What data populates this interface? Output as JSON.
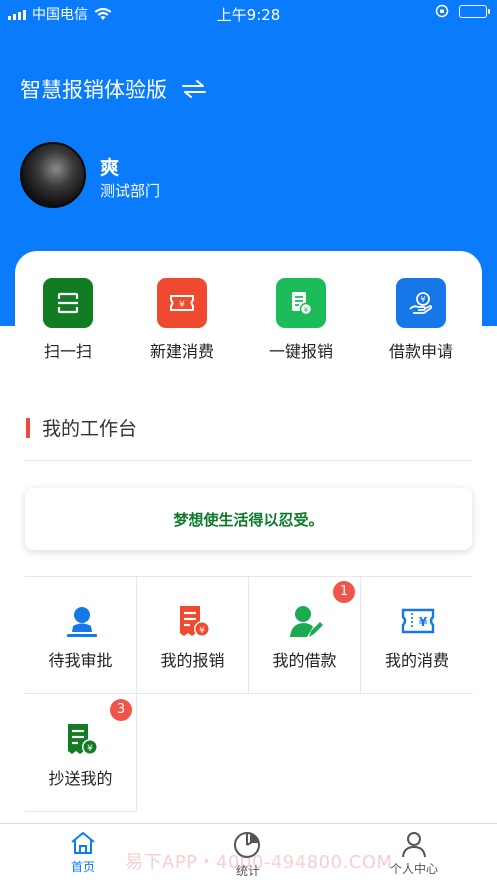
{
  "status_bar": {
    "carrier": "中国电信",
    "time": "上午9:28"
  },
  "header": {
    "app_title": "智慧报销体验版",
    "switch_icon": "switch-arrows-icon",
    "user_name": "爽",
    "department": "测试部门"
  },
  "quick_actions": [
    {
      "label": "扫一扫",
      "icon": "scan-icon",
      "color": "#127c23"
    },
    {
      "label": "新建消费",
      "icon": "ticket-icon",
      "color": "#ef4a30"
    },
    {
      "label": "一键报销",
      "icon": "receipt-check-icon",
      "color": "#1cbc5a"
    },
    {
      "label": "借款申请",
      "icon": "hand-money-icon",
      "color": "#1677e8"
    }
  ],
  "workbench": {
    "title": "我的工作台",
    "quote": "梦想使生活得以忍受。",
    "items": [
      {
        "label": "待我审批",
        "icon": "approver-icon",
        "color": "#1677e8",
        "badge": ""
      },
      {
        "label": "我的报销",
        "icon": "reimburse-icon",
        "color": "#ef4a30",
        "badge": ""
      },
      {
        "label": "我的借款",
        "icon": "user-edit-icon",
        "color": "#1aaa50",
        "badge": "1"
      },
      {
        "label": "我的消费",
        "icon": "ticket-yen-icon",
        "color": "#1677e8",
        "badge": ""
      },
      {
        "label": "抄送我的",
        "icon": "cc-doc-icon",
        "color": "#127c23",
        "badge": "3"
      }
    ]
  },
  "tab_bar": {
    "tabs": [
      {
        "label": "首页",
        "icon": "home-icon",
        "active": true
      },
      {
        "label": "统计",
        "icon": "pie-chart-icon",
        "active": false
      },
      {
        "label": "个人中心",
        "icon": "person-icon",
        "active": false
      }
    ],
    "active_color": "#0a7bfa",
    "inactive_color": "#555555"
  },
  "watermark": "易下APP・4000-494800.COM",
  "colors": {
    "header_blue": "#0a7bfa",
    "accent_red": "#f04a3a",
    "quote_green": "#0a7a2a"
  }
}
